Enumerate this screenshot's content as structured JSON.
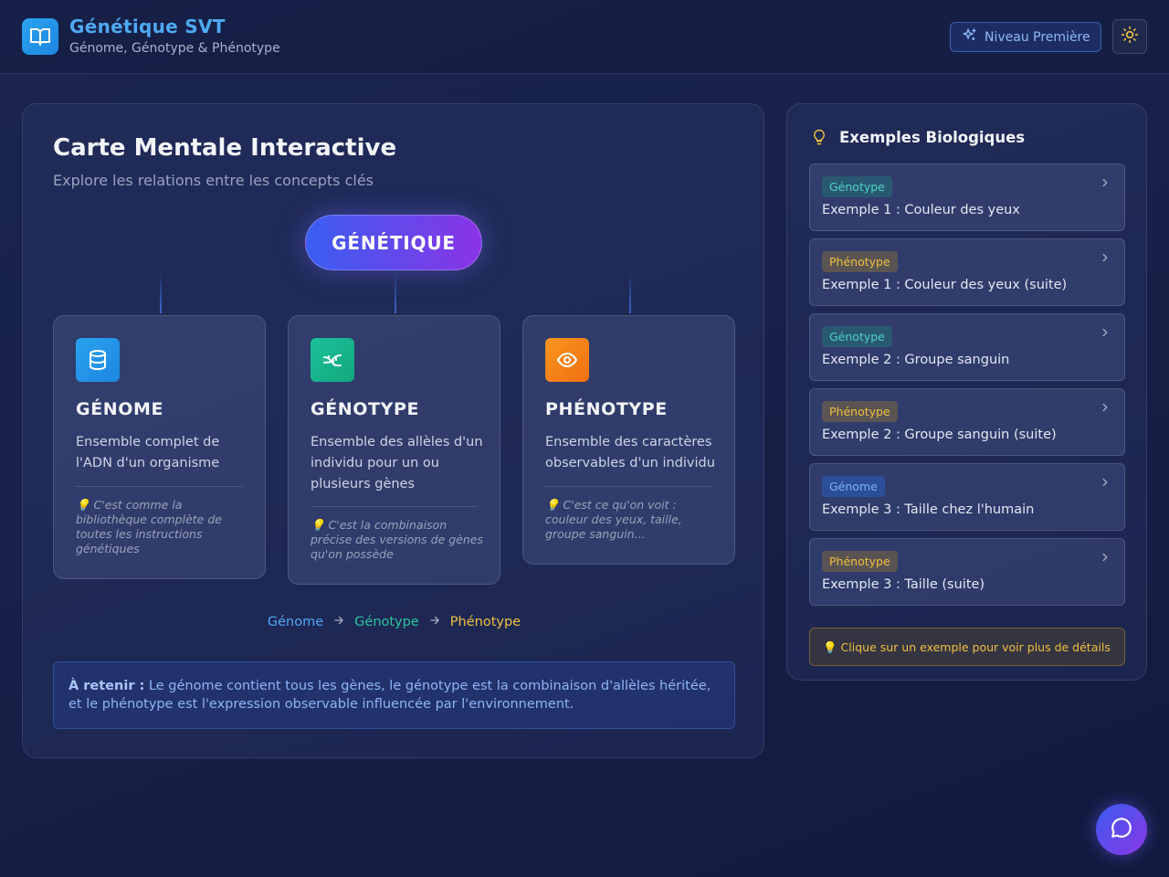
{
  "header": {
    "title": "Génétique SVT",
    "subtitle": "Génome, Génotype & Phénotype",
    "level_label": "Niveau Première"
  },
  "main": {
    "title": "Carte Mentale Interactive",
    "subtitle": "Explore les relations entre les concepts clés",
    "central_node": "GÉNÉTIQUE",
    "cards": [
      {
        "title": "GÉNOME",
        "description": "Ensemble complet de l'ADN d'un organisme",
        "note": "💡 C'est comme la bibliothèque complète de toutes les instructions génétiques",
        "icon": "database-icon",
        "color": "#2196e8"
      },
      {
        "title": "GÉNOTYPE",
        "description": "Ensemble des allèles d'un individu pour un ou plusieurs gènes",
        "note": "💡 C'est la combinaison précise des versions de gènes qu'on possède",
        "icon": "dna-icon",
        "color": "#16b38a"
      },
      {
        "title": "PHÉNOTYPE",
        "description": "Ensemble des caractères observables d'un individu",
        "note": "💡 C'est ce qu'on voit : couleur des yeux, taille, groupe sanguin...",
        "icon": "eye-icon",
        "color": "#f5841a"
      }
    ],
    "flow": [
      "Génome",
      "Génotype",
      "Phénotype"
    ],
    "retenir_label": "À retenir :",
    "retenir_text": "Le génome contient tous les gènes, le génotype est la combinaison d'allèles héritée, et le phénotype est l'expression observable influencée par l'environnement."
  },
  "side": {
    "title": "Exemples Biologiques",
    "examples": [
      {
        "tag": "Génotype",
        "title": "Exemple 1 : Couleur des yeux"
      },
      {
        "tag": "Phénotype",
        "title": "Exemple 1 : Couleur des yeux (suite)"
      },
      {
        "tag": "Génotype",
        "title": "Exemple 2 : Groupe sanguin"
      },
      {
        "tag": "Phénotype",
        "title": "Exemple 2 : Groupe sanguin (suite)"
      },
      {
        "tag": "Génome",
        "title": "Exemple 3 : Taille chez l'humain"
      },
      {
        "tag": "Phénotype",
        "title": "Exemple 3 : Taille (suite)"
      }
    ],
    "hint": "💡 Clique sur un exemple pour voir plus de détails"
  },
  "colors": {
    "accent_blue": "#4fa9f3",
    "genotype": "#4fd1c0",
    "phenotype": "#f0c040",
    "genome": "#7fb2f4"
  }
}
